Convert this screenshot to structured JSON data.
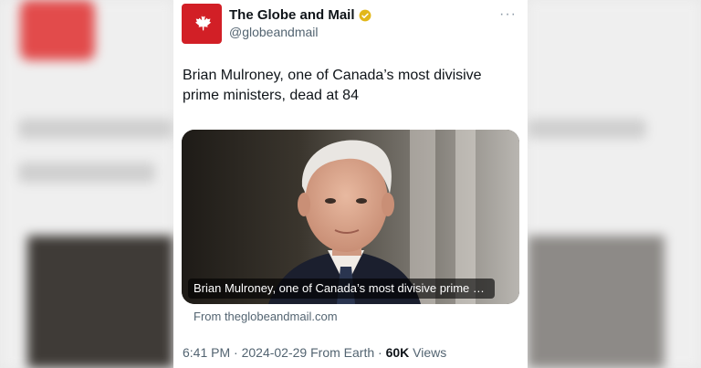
{
  "account": {
    "name": "The Globe and Mail",
    "handle": "@globeandmail",
    "verified": true,
    "avatar_color": "#d21f26",
    "avatar_icon": "maple-leaf-icon",
    "more_icon": "more-options-icon"
  },
  "post": {
    "text_line1": "Brian Mulroney, one of Canada’s most divisive",
    "text_line2": "prime ministers, dead at 84"
  },
  "link_card": {
    "caption": "Brian Mulroney, one of Canada’s most divisive prime mi...",
    "source": "From theglobeandmail.com"
  },
  "meta": {
    "time": "6:41 PM",
    "sep1": " · ",
    "date": "2024-02-29",
    "from": " From Earth",
    "sep2": " · ",
    "views_count": "60K",
    "views_label": " Views"
  }
}
